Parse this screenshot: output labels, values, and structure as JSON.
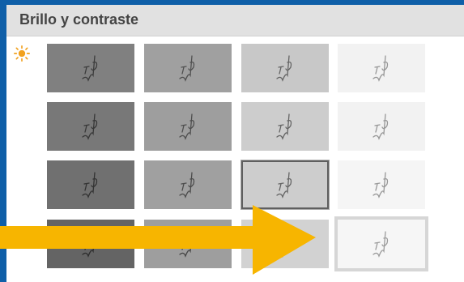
{
  "panel": {
    "title": "Brillo y contraste",
    "icon": "sun-icon"
  },
  "colors": {
    "accent_arrow": "#f7b500",
    "window_background": "#0f5fa8",
    "sun": "#f1a11e"
  },
  "grid": {
    "rows": 4,
    "columns": 4,
    "selected_cell": {
      "row": 3,
      "column": 3
    },
    "current_cell": {
      "row": 4,
      "column": 4
    }
  }
}
